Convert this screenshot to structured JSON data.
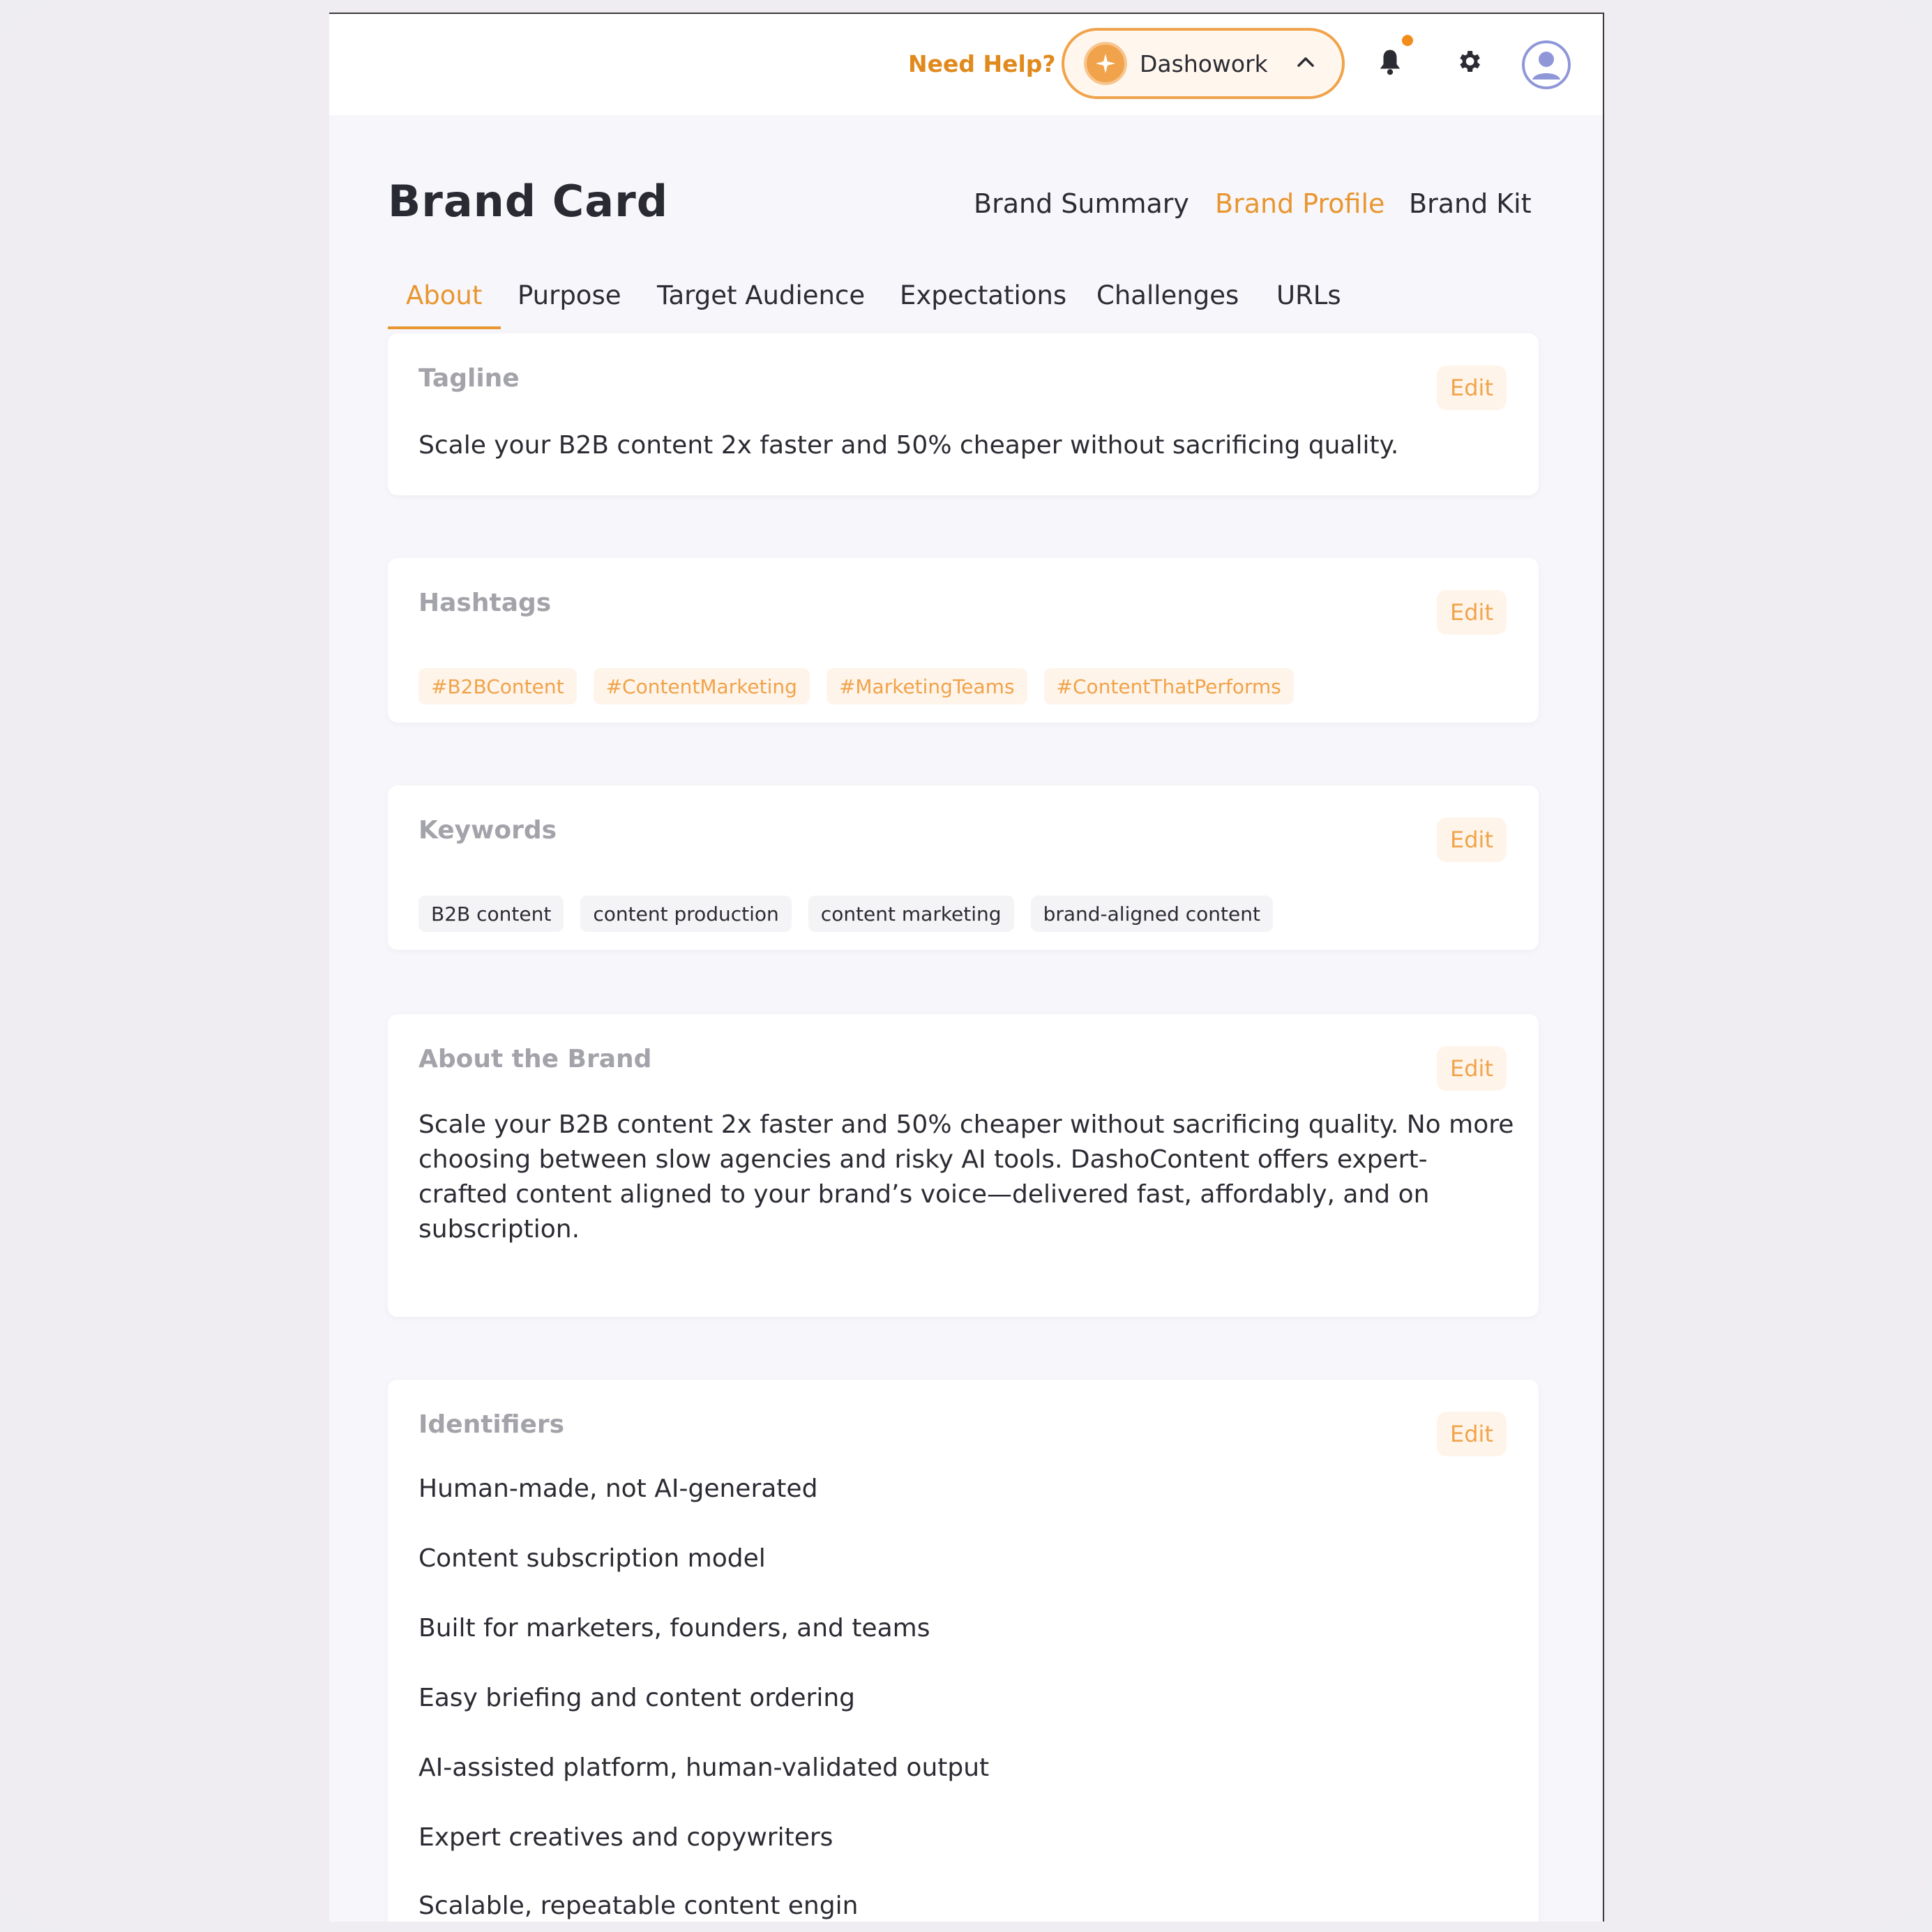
{
  "header": {
    "help_label": "Need Help?",
    "workspace_name": "Dashowork"
  },
  "page": {
    "title": "Brand Card",
    "top_nav": [
      "Brand Summary",
      "Brand Profile",
      "Brand Kit"
    ],
    "top_nav_active": "Brand Profile",
    "tabs": [
      "About",
      "Purpose",
      "Target Audience",
      "Expectations",
      "Challenges",
      "URLs"
    ],
    "tabs_active": "About"
  },
  "cards": {
    "edit_label": "Edit",
    "tagline": {
      "title": "Tagline",
      "text": "Scale your B2B content 2x faster and 50% cheaper without sacrificing quality."
    },
    "hashtags": {
      "title": "Hashtags",
      "items": [
        "#B2BContent",
        "#ContentMarketing",
        "#MarketingTeams",
        "#ContentThatPerforms"
      ]
    },
    "keywords": {
      "title": "Keywords",
      "items": [
        "B2B content",
        "content production",
        "content marketing",
        "brand-aligned content"
      ]
    },
    "about": {
      "title": "About the Brand",
      "lines": [
        "Scale your B2B content 2x faster and 50% cheaper without sacrificing quality. No more",
        "choosing between slow agencies and risky AI tools. DashoContent offers expert-",
        "crafted content aligned to your brand’s voice—delivered fast, affordably, and on",
        "subscription."
      ]
    },
    "identifiers": {
      "title": "Identifiers",
      "items": [
        "Human-made, not AI-generated",
        "Content subscription model",
        "Built for marketers, founders, and teams",
        "Easy briefing and content ordering",
        "AI-assisted platform, human-validated output",
        "Expert creatives and copywriters",
        "Scalable, repeatable content engin"
      ]
    }
  },
  "colors": {
    "accent": "#e8962f",
    "accent_light": "#fff4e9",
    "notification_dot": "#f28c1b"
  }
}
